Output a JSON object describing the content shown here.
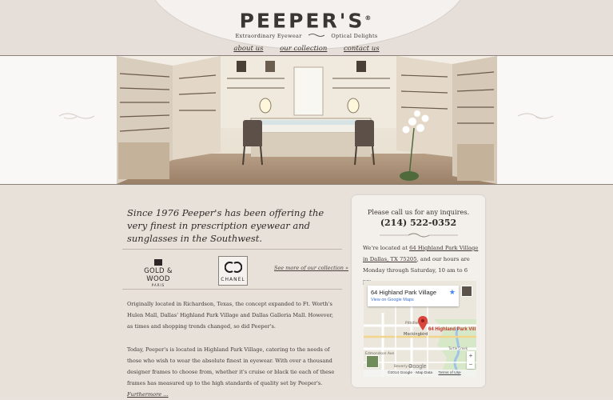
{
  "brand": {
    "name": "PEEPER'S",
    "reg": "®",
    "tagline_left": "Extraordinary Eyewear",
    "tagline_right": "Optical Delights"
  },
  "nav": {
    "items": [
      {
        "label": "about us"
      },
      {
        "label": "our collection"
      },
      {
        "label": "contact us"
      }
    ]
  },
  "intro": {
    "text": "Since 1976 Peeper's has been offering the very finest in prescription eyewear and sunglasses in the Southwest."
  },
  "brands": {
    "gold_wood": "GOLD & WOOD",
    "gold_wood_sub": "PARIS",
    "chanel": "CHANEL",
    "see_more": "See more of our collection »"
  },
  "body": {
    "p1": "Originally located in Richardson, Texas, the concept expanded to Ft. Worth's Hulen Mall, Dallas' Highland Park Village and Dallas Galleria Mall. However, as times and shopping trends changed, so did Peeper's.",
    "p2": "Today, Peeper's is located in Highland Park Village, catering to the needs of those who wish to wear the absolute finest in eyewear. With over a thousand designer frames to choose from, whether it's cruise or black tie each of these frames has measured up to the high standards of quality set by Peeper's.",
    "more": "Furthermore ..."
  },
  "sidebar": {
    "call": "Please call us for any inquires.",
    "phone": "(214) 522-0352",
    "loc_prefix": "We're located at ",
    "address": "64 Highland Park Village in Dallas, TX 75205",
    "loc_suffix": ", and our hours are Monday through Saturday, 10 am to 6 pm."
  },
  "map": {
    "card_title": "64 Highland Park Village",
    "card_link": "View on Google Maps",
    "pin_label": "64 Highland Park Vill",
    "footer": "©2014 Google · Map Data",
    "terms": "Terms of Use",
    "google": "Google",
    "streets": [
      "Pittsfield Ave",
      "Mockingbird",
      "Edmondson Ave",
      "Beverly Dr",
      "Turtle Creek"
    ]
  },
  "colors": {
    "page_bg": "#e9e2dc",
    "band_bg": "#faf8f6",
    "text": "#3a3230",
    "pin": "#d9443b",
    "map_water": "#aacbe8"
  }
}
